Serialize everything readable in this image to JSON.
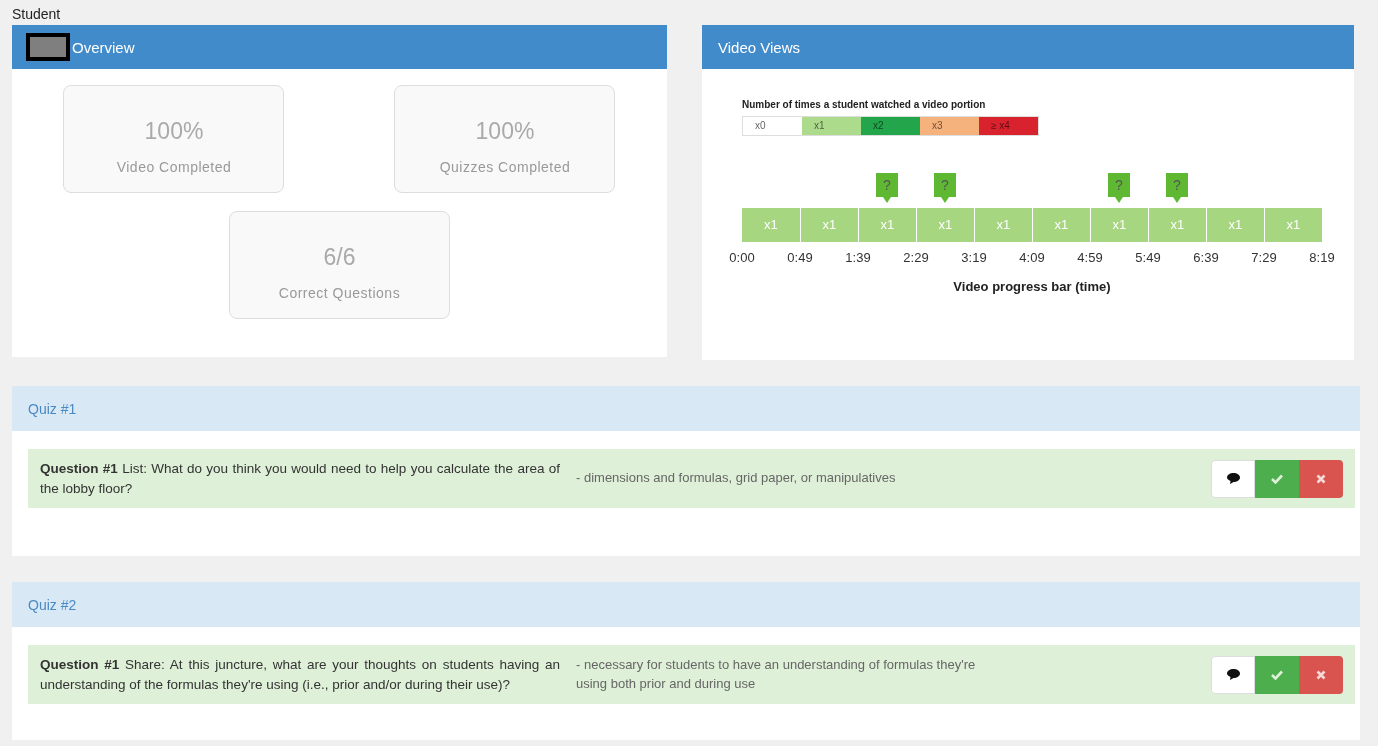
{
  "page_title": "Student",
  "overview": {
    "title": "Overview",
    "stats": [
      {
        "value": "100%",
        "label": "Video Completed"
      },
      {
        "value": "100%",
        "label": "Quizzes Completed"
      },
      {
        "value": "6/6",
        "label": "Correct Questions"
      }
    ]
  },
  "video_views": {
    "title": "Video Views",
    "legend_title": "Number of times a student watched a video portion",
    "legend": [
      {
        "label": "x0",
        "color": "#ffffff"
      },
      {
        "label": "x1",
        "color": "#addb8c"
      },
      {
        "label": "x2",
        "color": "#23a54b"
      },
      {
        "label": "x3",
        "color": "#f6b27c"
      },
      {
        "label": "≥ x4",
        "color": "#d8222d"
      }
    ],
    "segments": [
      {
        "label": "x1",
        "color": "#a6d67f"
      },
      {
        "label": "x1",
        "color": "#a6d67f"
      },
      {
        "label": "x1",
        "color": "#a6d67f",
        "marker": "?"
      },
      {
        "label": "x1",
        "color": "#a6d67f",
        "marker": "?"
      },
      {
        "label": "x1",
        "color": "#a6d67f"
      },
      {
        "label": "x1",
        "color": "#a6d67f"
      },
      {
        "label": "x1",
        "color": "#a6d67f",
        "marker": "?"
      },
      {
        "label": "x1",
        "color": "#a6d67f",
        "marker": "?"
      },
      {
        "label": "x1",
        "color": "#a6d67f"
      },
      {
        "label": "x1",
        "color": "#a6d67f"
      }
    ],
    "ticks": [
      "0:00",
      "0:49",
      "1:39",
      "2:29",
      "3:19",
      "4:09",
      "4:59",
      "5:49",
      "6:39",
      "7:29",
      "8:19"
    ],
    "axis_title": "Video progress bar (time)"
  },
  "quizzes": [
    {
      "title": "Quiz #1",
      "questions": [
        {
          "question": "**Question #1** List: What do you think you would need to help you calculate the area of the lobby floor?",
          "answer": "- dimensions and formulas, grid paper, or manipulatives",
          "correct": true
        }
      ]
    },
    {
      "title": "Quiz #2",
      "questions": [
        {
          "question": "**Question #1** Share: At this juncture, what are your thoughts on students having an understanding of the formulas they're using (i.e., prior and/or during their use)?",
          "answer": "- necessary for students to have an understanding of formulas they're using both prior and during use",
          "correct": true
        }
      ]
    }
  ]
}
